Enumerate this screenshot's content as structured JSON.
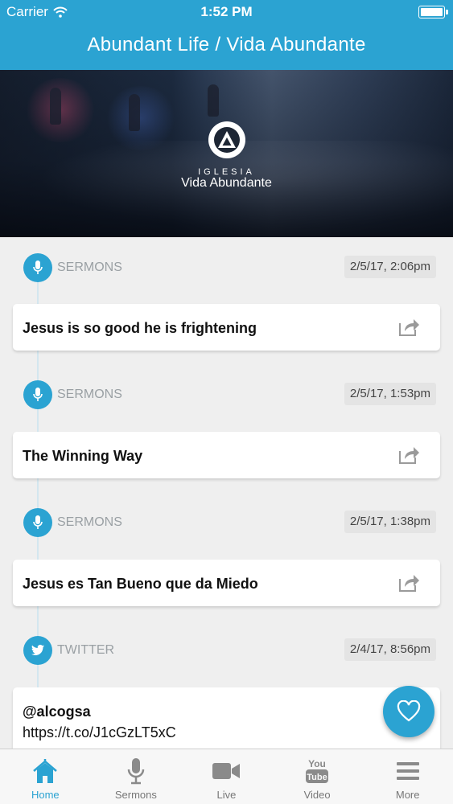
{
  "status_bar": {
    "carrier": "Carrier",
    "time": "1:52 PM"
  },
  "header": {
    "title": "Abundant Life / Vida Abundante"
  },
  "banner": {
    "logo_kicker": "IGLESIA",
    "logo_name": "Vida Abundante"
  },
  "feed": [
    {
      "type": "SERMONS",
      "icon": "microphone-icon",
      "date": "2/5/17, 2:06pm",
      "title": "Jesus is so good he is frightening"
    },
    {
      "type": "SERMONS",
      "icon": "microphone-icon",
      "date": "2/5/17, 1:53pm",
      "title": "The Winning Way"
    },
    {
      "type": "SERMONS",
      "icon": "microphone-icon",
      "date": "2/5/17, 1:38pm",
      "title": "Jesus es Tan Bueno que da Miedo"
    },
    {
      "type": "TWITTER",
      "icon": "twitter-bird-icon",
      "date": "2/4/17, 8:56pm",
      "handle": "@alcogsa",
      "link": "https://t.co/J1cGzLT5xC"
    }
  ],
  "tabs": [
    {
      "label": "Home",
      "icon": "home-icon",
      "active": true
    },
    {
      "label": "Sermons",
      "icon": "microphone-icon"
    },
    {
      "label": "Live",
      "icon": "video-camera-icon"
    },
    {
      "label": "Video",
      "icon": "youtube-icon"
    },
    {
      "label": "More",
      "icon": "menu-icon"
    }
  ],
  "colors": {
    "accent": "#2ba3d2",
    "background": "#efefef",
    "muted_text": "#9aa0a4"
  }
}
